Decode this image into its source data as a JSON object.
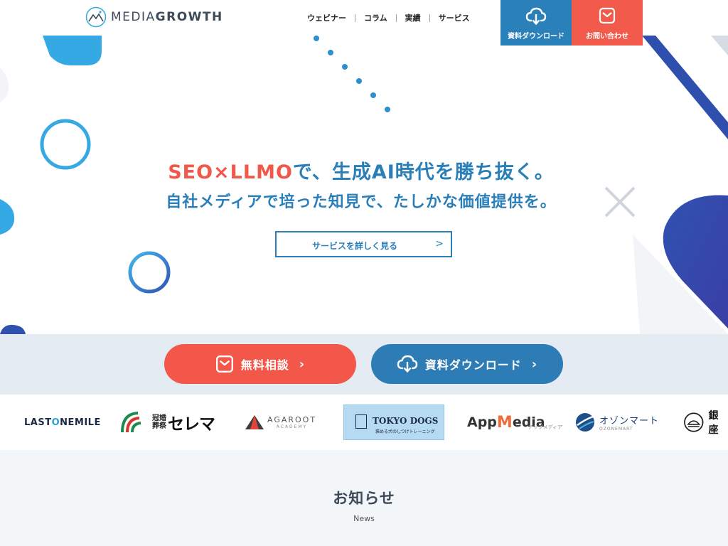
{
  "brand": {
    "name_light": "MEDIA",
    "name_bold": "GROWTH",
    "accent": "#2a7fb8"
  },
  "nav": {
    "items": [
      "ウェビナー",
      "コラム",
      "実績",
      "サービス"
    ]
  },
  "header_buttons": {
    "download": {
      "label": "資料ダウンロード",
      "icon": "cloud-download-icon",
      "color": "#2a80b9"
    },
    "contact": {
      "label": "お問い合わせ",
      "icon": "mail-icon",
      "color": "#f25b4c"
    }
  },
  "hero": {
    "title_accent": "SEO×LLMO",
    "title_rest": "で、生成AI時代を勝ち抜く。",
    "subtitle": "自社メディアで培った知見で、たしかな価値提供を。",
    "cta_label": "サービスを詳しく見る",
    "cta_chevron": ">"
  },
  "cta_band": {
    "consult": {
      "label": "無料相談",
      "icon": "mail-icon",
      "chevron": "›",
      "color": "#f2574a"
    },
    "download": {
      "label": "資料ダウンロード",
      "icon": "cloud-download-icon",
      "chevron": "›",
      "color": "#2d7cb5"
    }
  },
  "client_logos": {
    "lastonemile": {
      "pre": "LAST",
      "o": "O",
      "post": "NEMILE"
    },
    "cerema": {
      "k1": "冠婚",
      "k2": "葬祭",
      "big": "セレマ"
    },
    "agaroot": {
      "name": "AGAROOT",
      "sub": "ACADEMY"
    },
    "tokyodogs": {
      "name": "TOKYO DOGS",
      "sub": "褒める犬のしつけトレーニング"
    },
    "appmedia": {
      "app": "App",
      "m": "M",
      "edia": "edia",
      "sub": "アップメディア"
    },
    "zonemart": {
      "name": "オゾンマート",
      "sub": "OZONEMART"
    },
    "ginza": {
      "name": "銀座"
    }
  },
  "news": {
    "title": "お知らせ",
    "subtitle": "News"
  }
}
